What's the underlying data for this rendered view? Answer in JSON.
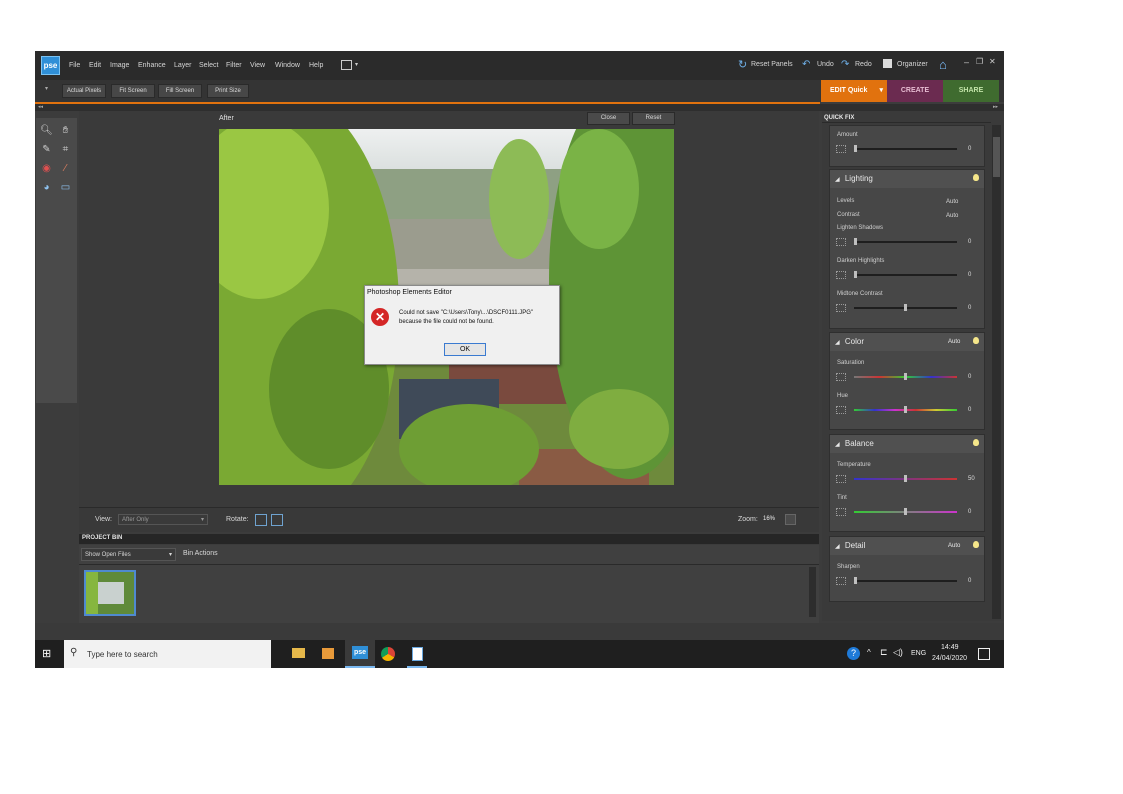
{
  "app": {
    "logo": "pse",
    "menus": [
      "File",
      "Edit",
      "Image",
      "Enhance",
      "Layer",
      "Select",
      "Filter",
      "View",
      "Window",
      "Help"
    ],
    "toolbar": {
      "reset_panels": "Reset Panels",
      "undo": "Undo",
      "redo": "Redo",
      "organizer": "Organizer"
    }
  },
  "options_bar": {
    "buttons": [
      "Actual Pixels",
      "Fit Screen",
      "Fill Screen",
      "Print Size"
    ]
  },
  "mode_tabs": {
    "edit": "EDIT Quick",
    "create": "CREATE",
    "share": "SHARE"
  },
  "canvas": {
    "title": "After",
    "close": "Close",
    "reset": "Reset"
  },
  "dialog": {
    "title": "Photoshop Elements Editor",
    "message_line1": "Could not save \"C:\\Users\\Tony\\...\\DSCF0111.JPG\"",
    "message_line2": "because the file could not be found.",
    "ok": "OK"
  },
  "view_bar": {
    "view_label": "View:",
    "view_value": "After Only",
    "rotate_label": "Rotate:",
    "zoom_label": "Zoom:",
    "zoom_value": "16%"
  },
  "project_bin": {
    "title": "PROJECT BIN",
    "show": "Show Open Files",
    "actions": "Bin Actions"
  },
  "quick_fix": {
    "title": "QUICK FIX",
    "amount": {
      "label": "Amount",
      "value": "0"
    },
    "lighting": {
      "title": "Lighting",
      "levels": "Levels",
      "contrast": "Contrast",
      "auto": "Auto",
      "shadows": {
        "label": "Lighten Shadows",
        "value": "0"
      },
      "highlights": {
        "label": "Darken Highlights",
        "value": "0"
      },
      "midtone": {
        "label": "Midtone Contrast",
        "value": "0"
      }
    },
    "color": {
      "title": "Color",
      "auto": "Auto",
      "saturation": {
        "label": "Saturation",
        "value": "0"
      },
      "hue": {
        "label": "Hue",
        "value": "0"
      }
    },
    "balance": {
      "title": "Balance",
      "temperature": {
        "label": "Temperature",
        "value": "50"
      },
      "tint": {
        "label": "Tint",
        "value": "0"
      }
    },
    "detail": {
      "title": "Detail",
      "auto": "Auto",
      "sharpen": {
        "label": "Sharpen",
        "value": "0"
      }
    }
  },
  "taskbar": {
    "search": "Type here to search",
    "lang": "ENG",
    "time": "14:49",
    "date": "24/04/2020"
  },
  "colors": {
    "accent": "#e1720e",
    "create": "#6b2b50",
    "share": "#3f6b2f",
    "taskbar": "#1f1f1f"
  }
}
